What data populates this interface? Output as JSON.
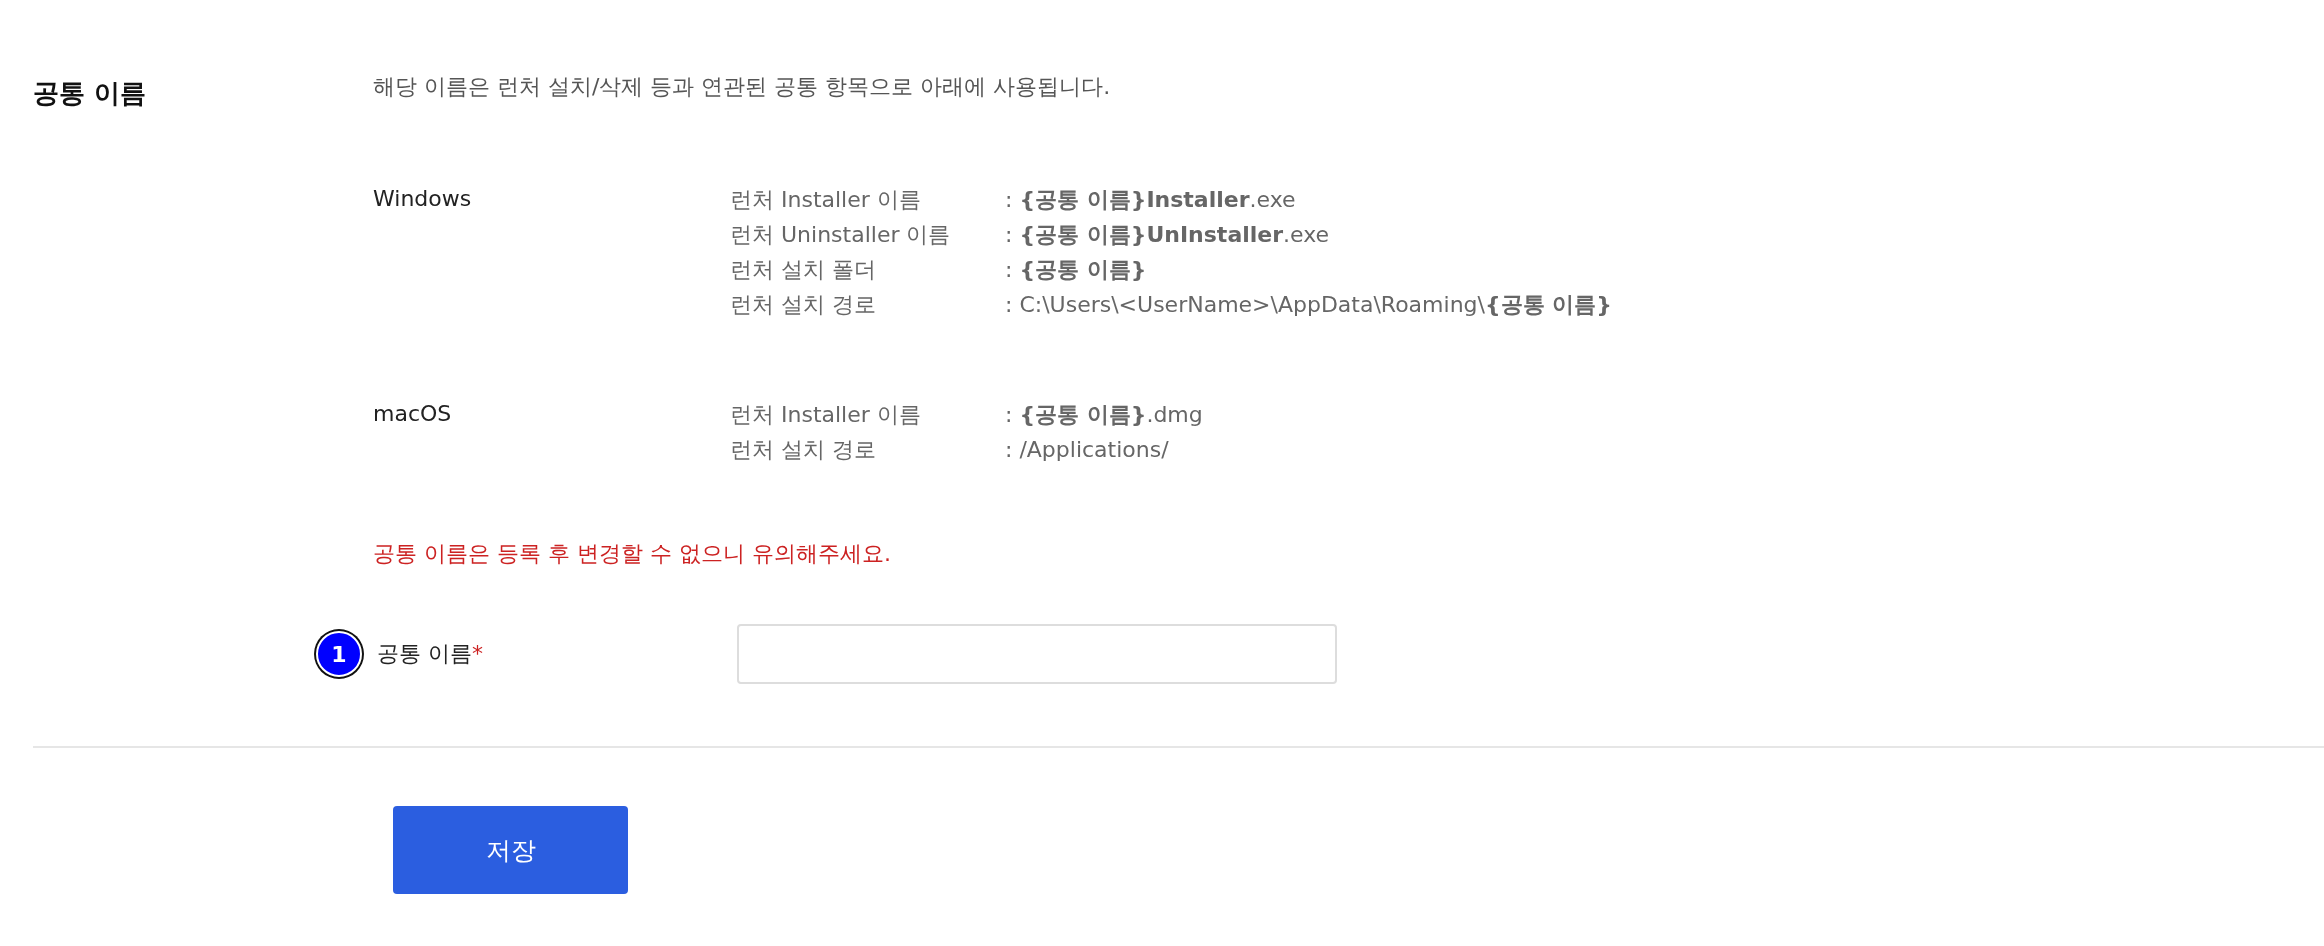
{
  "section": {
    "title": "공통 이름",
    "description": "해당 이름은 런처 설치/삭제 등과 연관된 공통 항목으로 아래에 사용됩니다.",
    "platforms": [
      {
        "name": "Windows",
        "rows": [
          {
            "label": "런처 Installer 이름",
            "value": ": **{공통 이름}Installer**.exe",
            "bold": false
          },
          {
            "label": "런처 Uninstaller 이름",
            "value": ": **{공통 이름}UnInstaller**.exe",
            "bold": false
          },
          {
            "label": "런처 설치 폴더",
            "value": ": **{공통 이름}**",
            "bold": false
          },
          {
            "label": "런처 설치 경로",
            "value": ": C:\\Users\\<UserName>\\AppData\\Roaming\\**{공통 이름}**",
            "bold": false
          }
        ]
      },
      {
        "name": "macOS",
        "rows": [
          {
            "label": "런처 Installer 이름",
            "value": ": **{공통 이름}**.dmg",
            "bold": false
          },
          {
            "label": "런처 설치 경로",
            "value": ": /Applications/",
            "bold": false
          }
        ]
      }
    ],
    "warning": "공통 이름은 등록 후 변경할 수 없으니 유의해주세요.",
    "field": {
      "step_badge": "1",
      "label": "공통 이름",
      "required_mark": "*"
    }
  },
  "buttons": [
    {
      "label": "저장"
    }
  ]
}
